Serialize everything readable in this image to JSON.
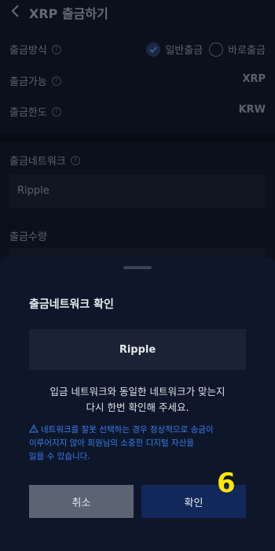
{
  "header": {
    "title": "XRP 출금하기"
  },
  "rows": {
    "method": {
      "label": "출금방식",
      "options": [
        "일반출금",
        "바로출금"
      ],
      "selected": "일반출금"
    },
    "available": {
      "label": "출금가능",
      "value": "XRP"
    },
    "limit": {
      "label": "출금한도",
      "value": "KRW"
    },
    "network": {
      "label": "출금네트워크",
      "value": "Ripple"
    },
    "amount": {
      "label": "출금수량"
    }
  },
  "dialog": {
    "title": "출금네트워크 확인",
    "network": "Ripple",
    "message_line1": "입금 네트워크와 동일한 네트워크가 맞는지",
    "message_line2": "다시 한번 확인해 주세요.",
    "warning_line1": "네트워크를 잘못 선택하는 경우 정상적으로 송금이",
    "warning_line2": "이루어지지 않아 회원님의 소중한 디지털 자산을",
    "warning_line3": "잃을 수 있습니다.",
    "cancel_label": "취소",
    "confirm_label": "확인"
  },
  "annotation": {
    "step": "6",
    "color": "#ffe800"
  },
  "colors": {
    "accent": "#3a7bf0",
    "confirm_bg": "#13285a",
    "cancel_bg": "#5c6473"
  }
}
